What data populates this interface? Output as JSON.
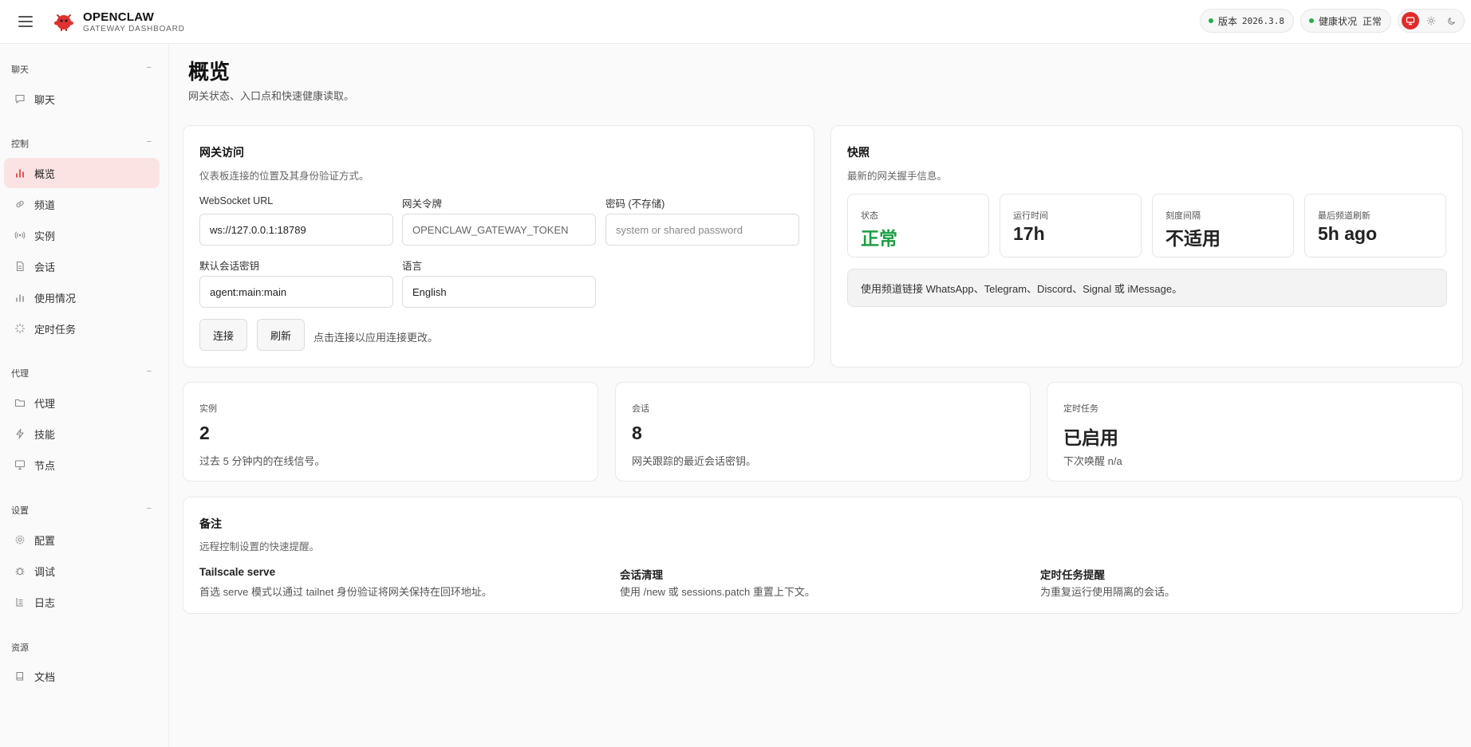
{
  "header": {
    "brand_title": "OPENCLAW",
    "brand_subtitle": "GATEWAY DASHBOARD",
    "version_label": "版本",
    "version_value": "2026.3.8",
    "health_label": "健康状况",
    "health_value": "正常",
    "status_color": "#22b04b",
    "accent_color": "#e02b2b"
  },
  "sidebar": {
    "sections": [
      {
        "label": "聊天",
        "items": [
          {
            "label": "聊天",
            "icon": "message-icon"
          }
        ]
      },
      {
        "label": "控制",
        "items": [
          {
            "label": "概览",
            "icon": "bar-chart-icon",
            "active": true
          },
          {
            "label": "频道",
            "icon": "link-icon"
          },
          {
            "label": "实例",
            "icon": "radio-icon"
          },
          {
            "label": "会话",
            "icon": "document-icon"
          },
          {
            "label": "使用情况",
            "icon": "usage-chart-icon"
          },
          {
            "label": "定时任务",
            "icon": "loader-icon"
          }
        ]
      },
      {
        "label": "代理",
        "items": [
          {
            "label": "代理",
            "icon": "folder-icon"
          },
          {
            "label": "技能",
            "icon": "bolt-icon"
          },
          {
            "label": "节点",
            "icon": "monitor-icon"
          }
        ]
      },
      {
        "label": "设置",
        "items": [
          {
            "label": "配置",
            "icon": "gear-icon"
          },
          {
            "label": "调试",
            "icon": "bug-icon"
          },
          {
            "label": "日志",
            "icon": "log-icon"
          }
        ]
      },
      {
        "label": "资源",
        "items": [
          {
            "label": "文档",
            "icon": "book-icon"
          }
        ]
      }
    ]
  },
  "page": {
    "title": "概览",
    "subtitle": "网关状态、入口点和快速健康读取。"
  },
  "access": {
    "title": "网关访问",
    "subtitle": "仪表板连接的位置及其身份验证方式。",
    "ws_label": "WebSocket URL",
    "ws_value": "ws://127.0.0.1:18789",
    "token_label": "网关令牌",
    "token_placeholder": "OPENCLAW_GATEWAY_TOKEN",
    "password_label": "密码 (不存储)",
    "password_placeholder": "system or shared password",
    "session_key_label": "默认会话密钥",
    "session_key_value": "agent:main:main",
    "language_label": "语言",
    "language_value": "English",
    "connect_label": "连接",
    "refresh_label": "刷新",
    "hint": "点击连接以应用连接更改。"
  },
  "snapshot": {
    "title": "快照",
    "subtitle": "最新的网关握手信息。",
    "stats": [
      {
        "label": "状态",
        "value": "正常"
      },
      {
        "label": "运行时间",
        "value": "17h"
      },
      {
        "label": "刻度间隔",
        "value": "不适用"
      },
      {
        "label": "最后频道刷新",
        "value": "5h ago"
      }
    ],
    "callout": "使用频道链接 WhatsApp、Telegram、Discord、Signal 或 iMessage。"
  },
  "metrics": [
    {
      "label": "实例",
      "value": "2",
      "sub": "过去 5 分钟内的在线信号。"
    },
    {
      "label": "会话",
      "value": "8",
      "sub": "网关跟踪的最近会话密钥。"
    },
    {
      "label": "定时任务",
      "value": "已启用",
      "sub": "下次唤醒 n/a"
    }
  ],
  "notes": {
    "title": "备注",
    "subtitle": "远程控制设置的快速提醒。",
    "items": [
      {
        "title": "Tailscale serve",
        "text": "首选 serve 模式以通过 tailnet 身份验证将网关保持在回环地址。"
      },
      {
        "title": "会话清理",
        "text": "使用 /new 或 sessions.patch 重置上下文。"
      },
      {
        "title": "定时任务提醒",
        "text": "为重复运行使用隔离的会话。"
      }
    ]
  }
}
